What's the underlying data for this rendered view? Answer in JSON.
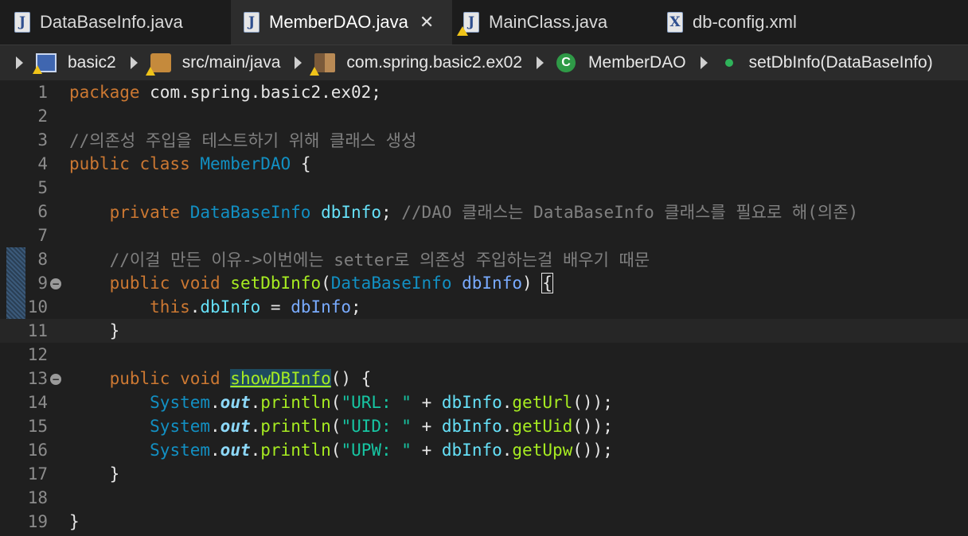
{
  "tabs": [
    {
      "label": "DataBaseInfo.java",
      "icon": "java-file-icon",
      "active": false,
      "warning": false
    },
    {
      "label": "MemberDAO.java",
      "icon": "java-file-icon",
      "active": true,
      "warning": false,
      "close": "✕"
    },
    {
      "label": "MainClass.java",
      "icon": "java-file-icon",
      "active": false,
      "warning": true
    },
    {
      "label": "db-config.xml",
      "icon": "xml-file-icon",
      "active": false,
      "warning": false
    }
  ],
  "breadcrumb": [
    {
      "label": "basic2",
      "icon": "project-icon"
    },
    {
      "label": "src/main/java",
      "icon": "source-folder-icon"
    },
    {
      "label": "com.spring.basic2.ex02",
      "icon": "package-icon"
    },
    {
      "label": "MemberDAO",
      "icon": "class-icon"
    },
    {
      "label": "setDbInfo(DataBaseInfo)",
      "icon": "method-icon"
    }
  ],
  "editor": {
    "current_line": 11,
    "lines": [
      {
        "n": "1",
        "tokens": [
          [
            "kw",
            "package"
          ],
          [
            "plain",
            " com.spring.basic2.ex02;"
          ]
        ]
      },
      {
        "n": "2",
        "tokens": []
      },
      {
        "n": "3",
        "tokens": [
          [
            "comment",
            "//의존성 주입을 테스트하기 위해 클래스 생성"
          ]
        ]
      },
      {
        "n": "4",
        "tokens": [
          [
            "kw",
            "public class "
          ],
          [
            "class",
            "MemberDAO"
          ],
          [
            "plain",
            " {"
          ]
        ]
      },
      {
        "n": "5",
        "tokens": []
      },
      {
        "n": "6",
        "tokens": [
          [
            "plain",
            "    "
          ],
          [
            "kw",
            "private "
          ],
          [
            "type",
            "DataBaseInfo "
          ],
          [
            "field",
            "dbInfo"
          ],
          [
            "plain",
            "; "
          ],
          [
            "comment",
            "//DAO 클래스는 DataBaseInfo 클래스를 필요로 해(의존)"
          ]
        ]
      },
      {
        "n": "7",
        "tokens": []
      },
      {
        "n": "8",
        "tokens": [
          [
            "plain",
            "    "
          ],
          [
            "comment",
            "//이걸 만든 이유->이번에는 setter로 의존성 주입하는걸 배우기 때문"
          ]
        ]
      },
      {
        "n": "9",
        "fold": true,
        "tokens": [
          [
            "plain",
            "    "
          ],
          [
            "kw",
            "public void "
          ],
          [
            "method",
            "setDbInfo"
          ],
          [
            "plain",
            "("
          ],
          [
            "type",
            "DataBaseInfo "
          ],
          [
            "param",
            "dbInfo"
          ],
          [
            "plain",
            ") "
          ],
          [
            "cursor",
            "{"
          ]
        ]
      },
      {
        "n": "10",
        "tokens": [
          [
            "plain",
            "        "
          ],
          [
            "kw",
            "this"
          ],
          [
            "plain",
            "."
          ],
          [
            "field",
            "dbInfo"
          ],
          [
            "plain",
            " = "
          ],
          [
            "param",
            "dbInfo"
          ],
          [
            "plain",
            ";"
          ]
        ]
      },
      {
        "n": "11",
        "tokens": [
          [
            "plain",
            "    }"
          ]
        ]
      },
      {
        "n": "12",
        "tokens": []
      },
      {
        "n": "13",
        "fold": true,
        "tokens": [
          [
            "plain",
            "    "
          ],
          [
            "kw",
            "public void "
          ],
          [
            "hl",
            "showDBInfo"
          ],
          [
            "plain",
            "() {"
          ]
        ]
      },
      {
        "n": "14",
        "tokens": [
          [
            "plain",
            "        "
          ],
          [
            "type",
            "System"
          ],
          [
            "plain",
            "."
          ],
          [
            "static",
            "out"
          ],
          [
            "plain",
            "."
          ],
          [
            "method",
            "println"
          ],
          [
            "plain",
            "("
          ],
          [
            "string",
            "\"URL: \""
          ],
          [
            "plain",
            " + "
          ],
          [
            "field",
            "dbInfo"
          ],
          [
            "plain",
            "."
          ],
          [
            "method",
            "getUrl"
          ],
          [
            "plain",
            "());"
          ]
        ]
      },
      {
        "n": "15",
        "tokens": [
          [
            "plain",
            "        "
          ],
          [
            "type",
            "System"
          ],
          [
            "plain",
            "."
          ],
          [
            "static",
            "out"
          ],
          [
            "plain",
            "."
          ],
          [
            "method",
            "println"
          ],
          [
            "plain",
            "("
          ],
          [
            "string",
            "\"UID: \""
          ],
          [
            "plain",
            " + "
          ],
          [
            "field",
            "dbInfo"
          ],
          [
            "plain",
            "."
          ],
          [
            "method",
            "getUid"
          ],
          [
            "plain",
            "());"
          ]
        ]
      },
      {
        "n": "16",
        "tokens": [
          [
            "plain",
            "        "
          ],
          [
            "type",
            "System"
          ],
          [
            "plain",
            "."
          ],
          [
            "static",
            "out"
          ],
          [
            "plain",
            "."
          ],
          [
            "method",
            "println"
          ],
          [
            "plain",
            "("
          ],
          [
            "string",
            "\"UPW: \""
          ],
          [
            "plain",
            " + "
          ],
          [
            "field",
            "dbInfo"
          ],
          [
            "plain",
            "."
          ],
          [
            "method",
            "getUpw"
          ],
          [
            "plain",
            "());"
          ]
        ]
      },
      {
        "n": "17",
        "tokens": [
          [
            "plain",
            "    }"
          ]
        ]
      },
      {
        "n": "18",
        "tokens": []
      },
      {
        "n": "19",
        "tokens": [
          [
            "plain",
            "}"
          ]
        ]
      }
    ]
  }
}
